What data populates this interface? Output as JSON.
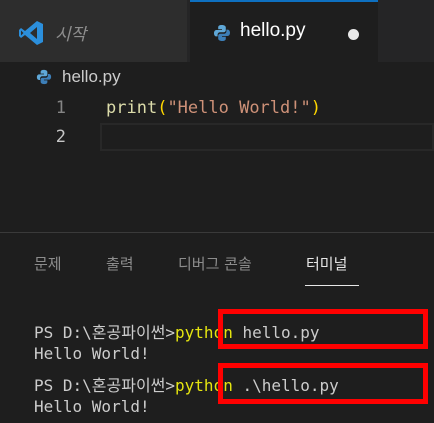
{
  "tabs": {
    "start_label": "시작",
    "file_label": "hello.py",
    "file_unsaved": true
  },
  "breadcrumb": {
    "file": "hello.py"
  },
  "editor": {
    "line_numbers": [
      "1",
      "2"
    ],
    "line1": {
      "fn": "print",
      "open_paren": "(",
      "string": "\"Hello World!\"",
      "close_paren": ")"
    },
    "line2": ""
  },
  "panel": {
    "tabs": [
      "문제",
      "출력",
      "디버그 콘솔",
      "터미널"
    ],
    "active_tab": "터미널"
  },
  "terminal": {
    "lines": [
      {
        "prompt": "PS D:\\혼공파이썬>",
        "cmd": "python",
        "arg": " hello.py"
      },
      {
        "output": "Hello World!"
      },
      {
        "prompt": "PS D:\\혼공파이썬>",
        "cmd": "python",
        "arg": " .\\hello.py"
      },
      {
        "output": "Hello World!"
      }
    ]
  },
  "colors": {
    "tab_active_border": "#0e70c0",
    "highlight_box": "#ff0000",
    "terminal_command": "#e5e510"
  },
  "icons": {
    "app": "vscode-icon",
    "file": "python-file-icon"
  }
}
